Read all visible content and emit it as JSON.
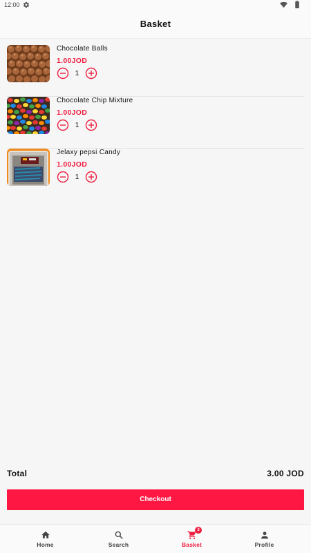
{
  "status_bar": {
    "time": "12:00"
  },
  "header": {
    "title": "Basket"
  },
  "basket": {
    "items": [
      {
        "name": "Chocolate Balls",
        "price": "1.00JOD",
        "quantity": "1"
      },
      {
        "name": "Chocolate Chip Mixture",
        "price": "1.00JOD",
        "quantity": "1"
      },
      {
        "name": "Jelaxy pepsi Candy",
        "price": "1.00JOD",
        "quantity": "1"
      }
    ]
  },
  "summary": {
    "total_label": "Total",
    "total_value": "3.00 JOD"
  },
  "checkout": {
    "label": "Checkout"
  },
  "nav": {
    "items": [
      {
        "label": "Home",
        "icon": "home-icon"
      },
      {
        "label": "Search",
        "icon": "search-icon"
      },
      {
        "label": "Basket",
        "icon": "cart-icon",
        "badge": "3"
      },
      {
        "label": "Profile",
        "icon": "person-icon"
      }
    ]
  },
  "colors": {
    "accent": "#ee1c3f",
    "button": "#ff1744",
    "background": "#f6f6f6"
  }
}
